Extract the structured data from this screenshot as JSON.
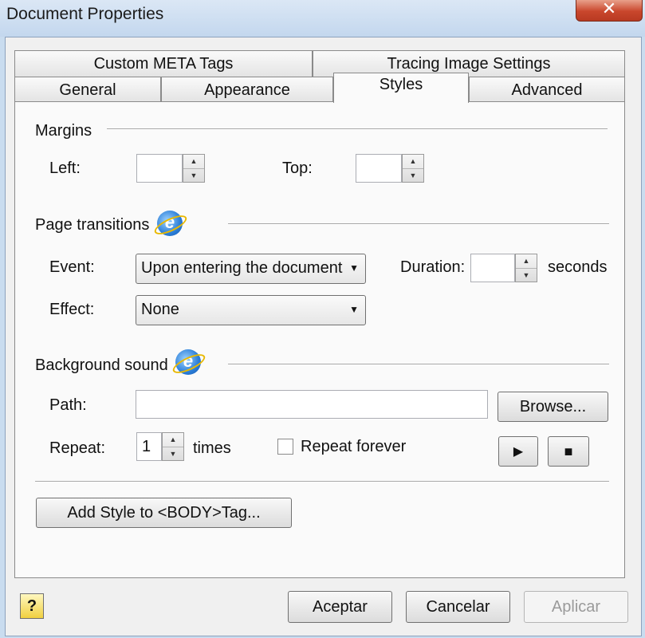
{
  "window": {
    "title": "Document Properties",
    "close_glyph": "✕"
  },
  "tabs": {
    "row1": [
      {
        "label": "Custom META Tags"
      },
      {
        "label": "Tracing Image Settings"
      }
    ],
    "row2": [
      {
        "label": "General"
      },
      {
        "label": "Appearance"
      },
      {
        "label": "Styles"
      },
      {
        "label": "Advanced"
      }
    ],
    "active": "Styles"
  },
  "margins": {
    "section_label": "Margins",
    "left_label": "Left:",
    "left_value": "",
    "top_label": "Top:",
    "top_value": ""
  },
  "page_transitions": {
    "section_label": "Page transitions",
    "event_label": "Event:",
    "event_value": "Upon entering the document",
    "duration_label": "Duration:",
    "duration_value": "",
    "duration_units": "seconds",
    "effect_label": "Effect:",
    "effect_value": "None"
  },
  "background_sound": {
    "section_label": "Background sound",
    "path_label": "Path:",
    "path_value": "",
    "browse_label": "Browse...",
    "repeat_label": "Repeat:",
    "repeat_value": "1",
    "repeat_units": "times",
    "repeat_forever_label": "Repeat forever",
    "repeat_forever_checked": false,
    "play_glyph": "▶",
    "stop_glyph": "■"
  },
  "add_style_label": "Add Style to <BODY>Tag...",
  "footer": {
    "help_glyph": "?",
    "ok_label": "Aceptar",
    "cancel_label": "Cancelar",
    "apply_label": "Aplicar"
  },
  "icons": {
    "ie": "internet-explorer-icon",
    "spin": "spinner-arrows-icon",
    "dropdown": "chevron-down-icon",
    "help": "help-icon",
    "play": "play-icon",
    "stop": "stop-icon",
    "close": "close-icon"
  },
  "colors": {
    "title_bar": "#c3d7ee",
    "close_button": "#c9462c",
    "panel_background": "#fafafa",
    "dialog_background": "#f0f0f0"
  }
}
